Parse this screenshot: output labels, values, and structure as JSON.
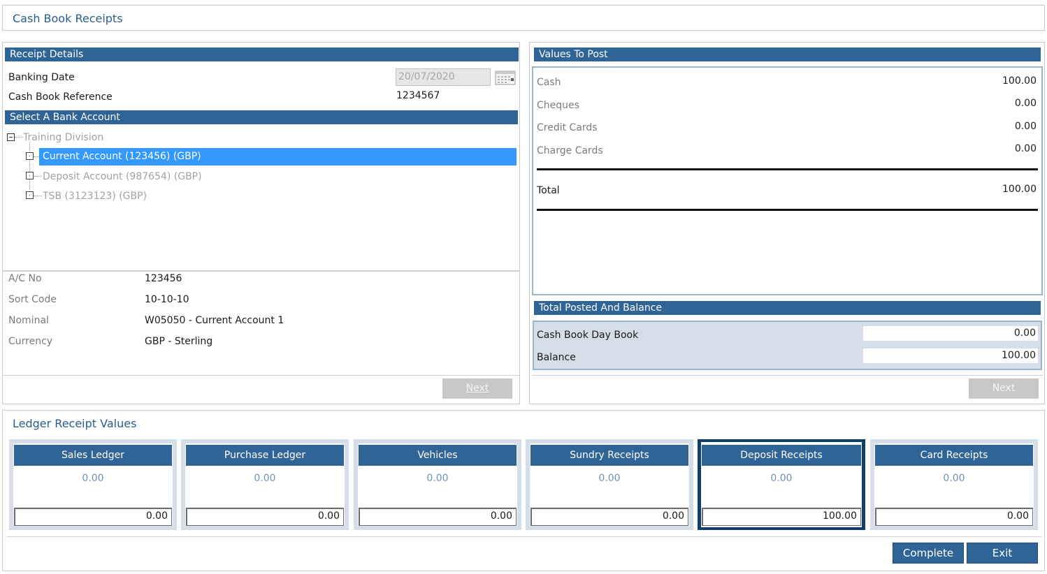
{
  "page": {
    "title": "Cash Book Receipts"
  },
  "receipt_details": {
    "header": "Receipt Details",
    "banking_date_label": "Banking Date",
    "banking_date_value": "20/07/2020",
    "reference_label": "Cash Book Reference",
    "reference_value": "1234567"
  },
  "bank_account": {
    "header": "Select A Bank Account",
    "root": "Training Division",
    "items": [
      {
        "label": "Current Account (123456) (GBP)",
        "selected": true
      },
      {
        "label": "Deposit Account (987654) (GBP)",
        "selected": false
      },
      {
        "label": "TSB (3123123) (GBP)",
        "selected": false
      }
    ]
  },
  "account_info": {
    "rows": [
      {
        "label": "A/C No",
        "value": "123456"
      },
      {
        "label": "Sort Code",
        "value": "10-10-10"
      },
      {
        "label": "Nominal",
        "value": "W05050 - Current Account 1"
      },
      {
        "label": "Currency",
        "value": "GBP - Sterling"
      }
    ],
    "next_label": "Next"
  },
  "values_to_post": {
    "header": "Values To Post",
    "rows": [
      {
        "label": "Cash",
        "value": "100.00"
      },
      {
        "label": "Cheques",
        "value": "0.00"
      },
      {
        "label": "Credit Cards",
        "value": "0.00"
      },
      {
        "label": "Charge Cards",
        "value": "0.00"
      }
    ],
    "total_label": "Total",
    "total_value": "100.00"
  },
  "balance": {
    "header": "Total Posted And Balance",
    "day_book_label": "Cash Book Day Book",
    "day_book_value": "0.00",
    "balance_label": "Balance",
    "balance_value": "100.00",
    "next_label": "Next"
  },
  "ledger": {
    "title": "Ledger Receipt Values",
    "cards": [
      {
        "name": "Sales Ledger",
        "posted": "0.00",
        "input": "0.00",
        "active": false
      },
      {
        "name": "Purchase Ledger",
        "posted": "0.00",
        "input": "0.00",
        "active": false
      },
      {
        "name": "Vehicles",
        "posted": "0.00",
        "input": "0.00",
        "active": false
      },
      {
        "name": "Sundry Receipts",
        "posted": "0.00",
        "input": "0.00",
        "active": false
      },
      {
        "name": "Deposit Receipts",
        "posted": "0.00",
        "input": "100.00",
        "active": true
      },
      {
        "name": "Card Receipts",
        "posted": "0.00",
        "input": "0.00",
        "active": false
      }
    ],
    "complete_label": "Complete",
    "exit_label": "Exit"
  },
  "colors": {
    "accent": "#2f6497",
    "selection": "#3399ff",
    "active_card_border": "#123e6c"
  }
}
